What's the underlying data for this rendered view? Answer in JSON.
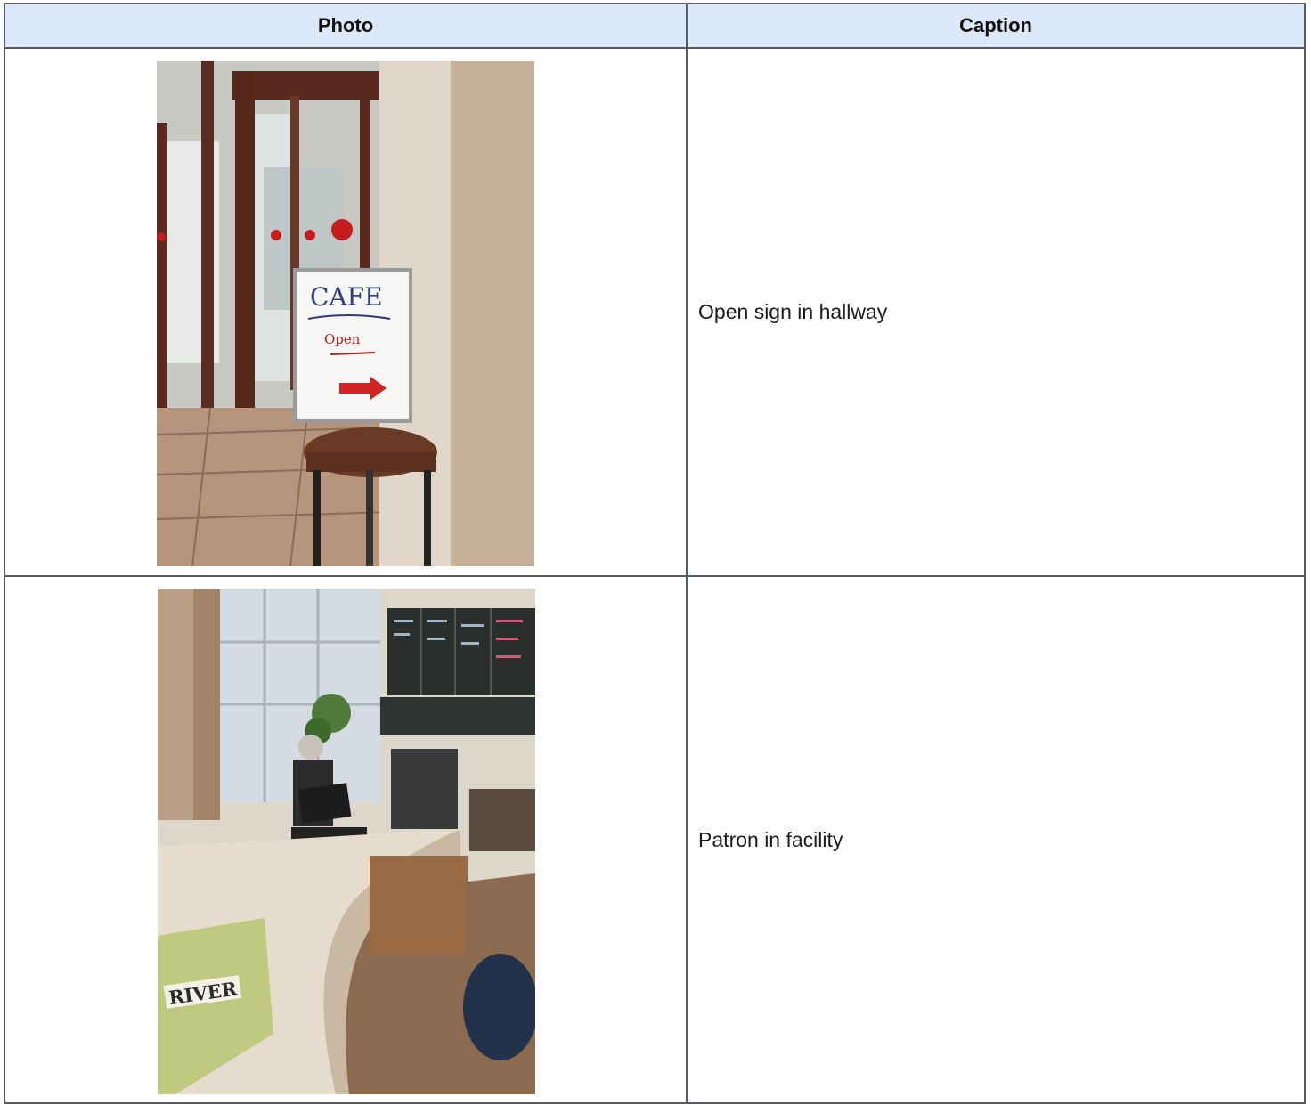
{
  "table": {
    "headers": {
      "photo": "Photo",
      "caption": "Caption"
    },
    "rows": [
      {
        "caption": "Open sign in hallway",
        "photo_sign_text": "CAFE Open"
      },
      {
        "caption": "Patron in facility",
        "photo_bag_text": "RIVER"
      }
    ]
  },
  "colors": {
    "header_bg": "#dce8f7",
    "border": "#555b66"
  }
}
